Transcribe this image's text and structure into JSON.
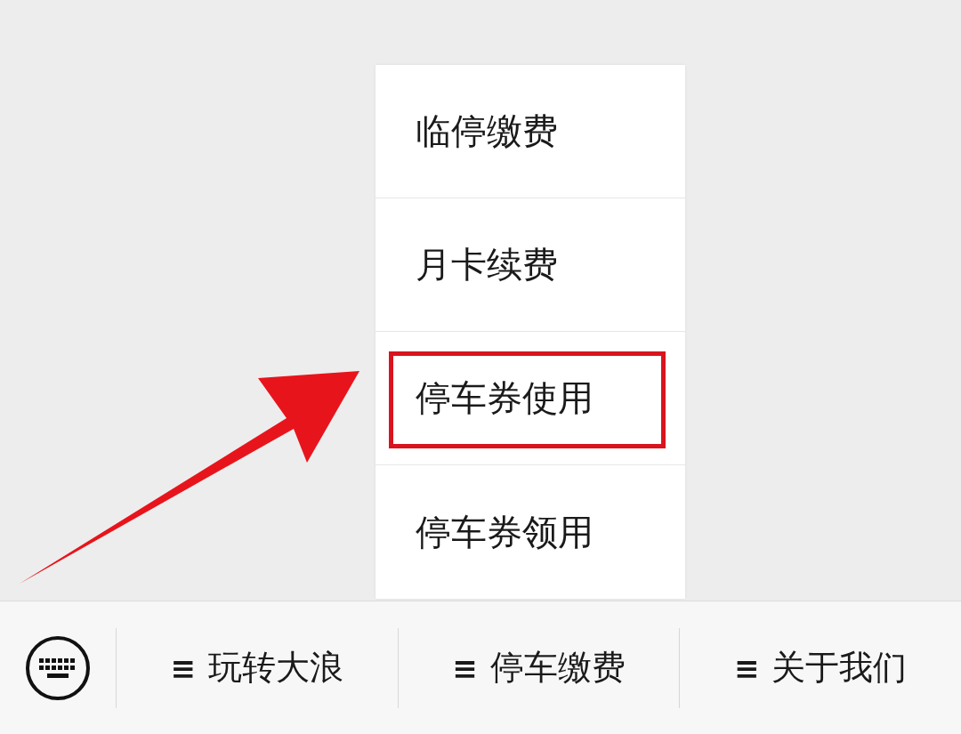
{
  "popup_menu": {
    "items": [
      {
        "label": "临停缴费",
        "selected": false
      },
      {
        "label": "月卡续费",
        "selected": false
      },
      {
        "label": "停车券使用",
        "selected": true
      },
      {
        "label": "停车券领用",
        "selected": false
      }
    ]
  },
  "bottom_menu": {
    "items": [
      {
        "icon": "≡",
        "label": "玩转大浪"
      },
      {
        "icon": "≡",
        "label": "停车缴费"
      },
      {
        "icon": "≡",
        "label": "关于我们"
      }
    ]
  }
}
